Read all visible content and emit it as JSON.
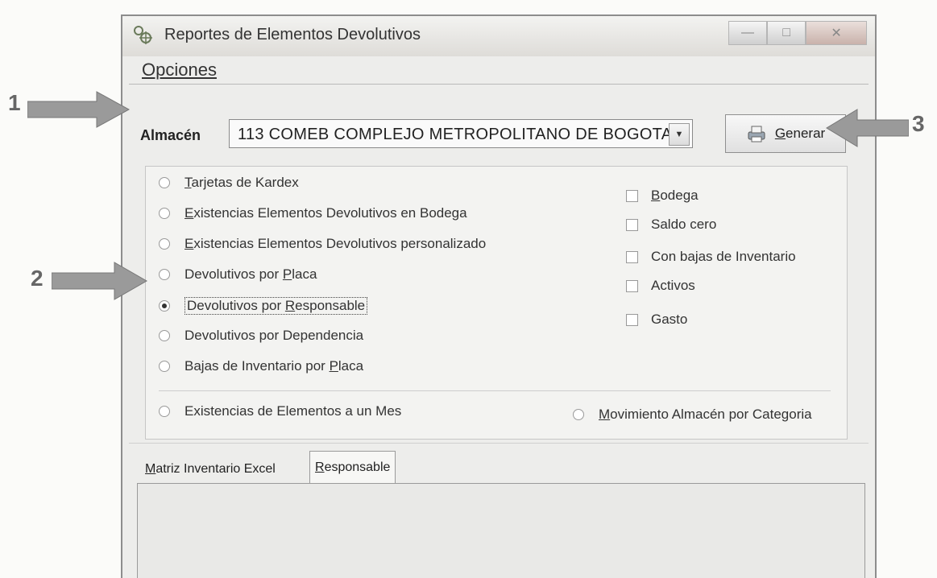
{
  "window": {
    "title": "Reportes de Elementos Devolutivos",
    "close_glyph": "✕",
    "minimize_glyph": "—",
    "maximize_glyph": "□"
  },
  "section": {
    "title": "Opciones"
  },
  "almacen": {
    "label": "Almacén",
    "value": "113 COMEB COMPLEJO METROPOLITANO DE BOGOTA"
  },
  "generar": {
    "label_first": "G",
    "label_rest": "enerar"
  },
  "report_options": [
    {
      "first": "T",
      "rest": "arjetas de Kardex",
      "selected": false
    },
    {
      "first": "E",
      "rest": "xistencias Elementos Devolutivos en Bodega",
      "selected": false
    },
    {
      "first": "E",
      "rest": "xistencias Elementos Devolutivos personalizado",
      "selected": false
    },
    {
      "pre": "Devolutivos por ",
      "first": "P",
      "rest": "laca",
      "selected": false
    },
    {
      "pre": "Devolutivos por ",
      "first": "R",
      "rest": "esponsable",
      "selected": true
    },
    {
      "pre": "Devolutivos por Dependencia",
      "selected": false
    },
    {
      "pre": "Bajas de Inventario por ",
      "first": "P",
      "rest": "laca",
      "selected": false
    }
  ],
  "checkboxes": [
    {
      "first": "B",
      "rest": "odega",
      "checked": false
    },
    {
      "label": "Saldo cero",
      "checked": false
    },
    {
      "label": "Con bajas de Inventario",
      "checked": false
    },
    {
      "label": "Activos",
      "checked": false
    },
    {
      "label": "Gasto",
      "checked": false
    }
  ],
  "bottom_options": {
    "existencias": "Existencias de Elementos a un Mes",
    "movimiento_first": "M",
    "movimiento_rest": "ovimiento Almacén por Categoria"
  },
  "tabs": {
    "matriz_first": "M",
    "matriz_rest": "atriz Inventario Excel",
    "responsable_first": "R",
    "responsable_rest": "esponsable"
  },
  "callouts": {
    "one": "1",
    "two": "2",
    "three": "3"
  },
  "colors": {
    "window_bg": "#ededeb",
    "panel_bg": "#f3f3f1",
    "arrow": "#9a9a9a"
  }
}
